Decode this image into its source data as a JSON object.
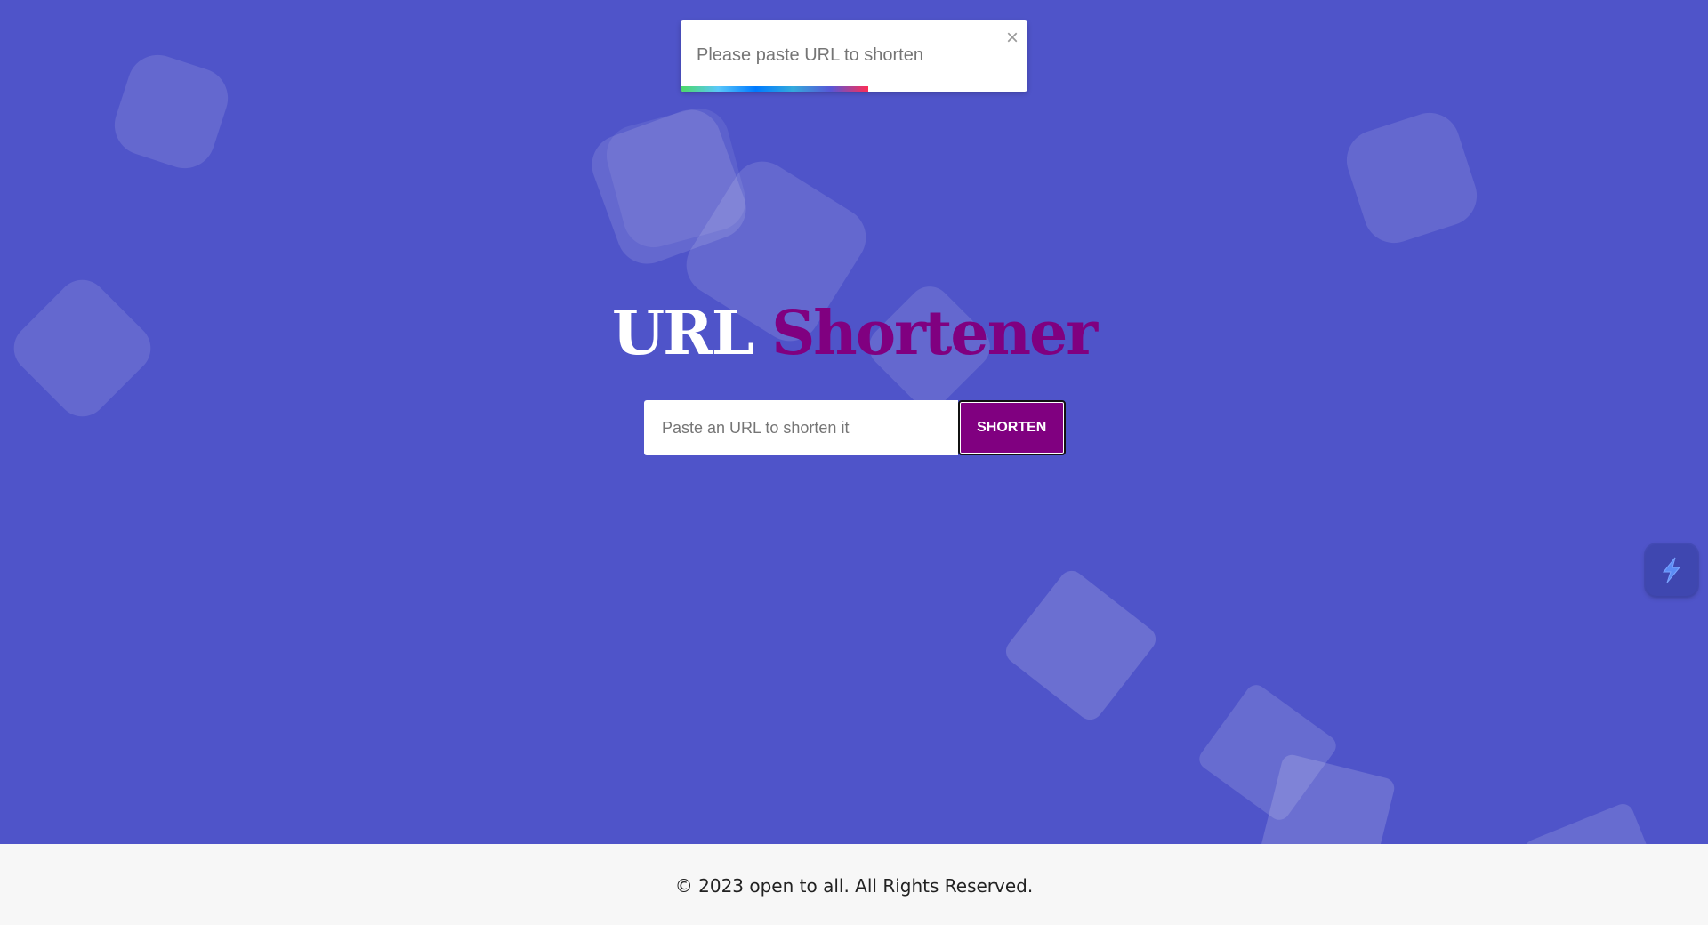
{
  "toast": {
    "message": "Please paste URL to shorten",
    "close_symbol": "×",
    "progress": 0.54,
    "close_icon": "close-icon"
  },
  "header": {
    "title_part_1": "URL",
    "title_part_2": "Shortener"
  },
  "form": {
    "input_placeholder": "Paste an URL to shorten it",
    "input_value": "",
    "button_label": "SHORTEN"
  },
  "widget": {
    "icon": "bolt-icon"
  },
  "footer": {
    "text": "© 2023 open to all. All Rights Reserved."
  },
  "colors": {
    "background": "#4f54c9",
    "accent": "#800080",
    "footer_background": "#f7f7f7"
  }
}
